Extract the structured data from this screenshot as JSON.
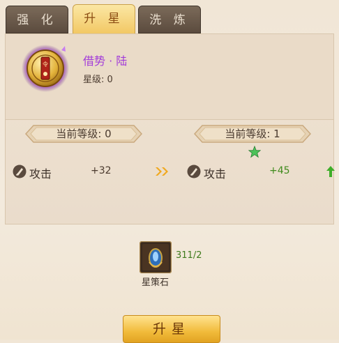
{
  "tabs": [
    {
      "label": "强 化",
      "active": false
    },
    {
      "label": "升 星",
      "active": true
    },
    {
      "label": "洗 炼",
      "active": false
    }
  ],
  "skill": {
    "name": "借势 · 陆",
    "star_level": "星级: 0",
    "emblem_icon": "skill-emblem-icon"
  },
  "current": {
    "level_label": "当前等级: 0",
    "stat_label": "攻击",
    "stat_value": "+32"
  },
  "next": {
    "level_label": "当前等级: 1",
    "stat_label": "攻击",
    "stat_value": "+45"
  },
  "material": {
    "name": "星策石",
    "count": "311/2",
    "icon": "star-strategy-stone-icon"
  },
  "upgrade_button": {
    "label": "升星"
  },
  "colors": {
    "skill_name": "#a23bd9",
    "value_current": "#4a3a2e",
    "value_next": "#3f8a1c",
    "tab_active": "#f2c763",
    "tab_inactive": "#5b4b3e"
  }
}
